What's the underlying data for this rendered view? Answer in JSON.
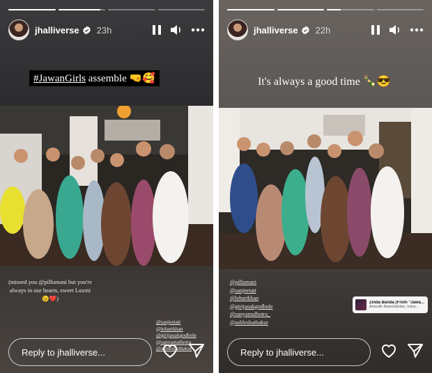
{
  "stories": [
    {
      "username": "jhalliverse",
      "time": "23h",
      "progress": [
        1,
        0.9,
        0,
        0
      ],
      "caption_hashtag": "#JawanGirls",
      "caption_rest": " assemble 🤜🥰",
      "note": "(missed you @pillumani but you're always in our hearts, sweet Laxmi 😉❤️)",
      "tags": [
        "@sanjeetatt",
        "@lehartkhan",
        "@girijaoakgodbole",
        "@sanyamalhotra_",
        "@ashleshathakur"
      ],
      "reply_placeholder": "Reply to jhalliverse..."
    },
    {
      "username": "jhalliverse",
      "time": "22h",
      "progress": [
        1,
        1,
        0.3,
        0
      ],
      "caption": "It's always a good time 🍾😎",
      "tags": [
        "@pillumani",
        "@sanjeetatt",
        "@lehartkhan",
        "@girijaoakgodbole",
        "@sanyamalhotra_",
        "@ashleshathakur"
      ],
      "music_title": "Zinda Banda (From \"Jawa...",
      "music_artist": "Anirudh Ravichander, Irsha...",
      "reply_placeholder": "Reply to jhalliverse..."
    }
  ],
  "icons": {
    "verified": "verified-badge-icon",
    "pause": "pause-icon",
    "volume": "volume-icon",
    "more": "more-icon",
    "heart": "heart-icon",
    "send": "send-icon"
  },
  "colors": {
    "verified": "#3897f0",
    "text": "#ffffff"
  }
}
